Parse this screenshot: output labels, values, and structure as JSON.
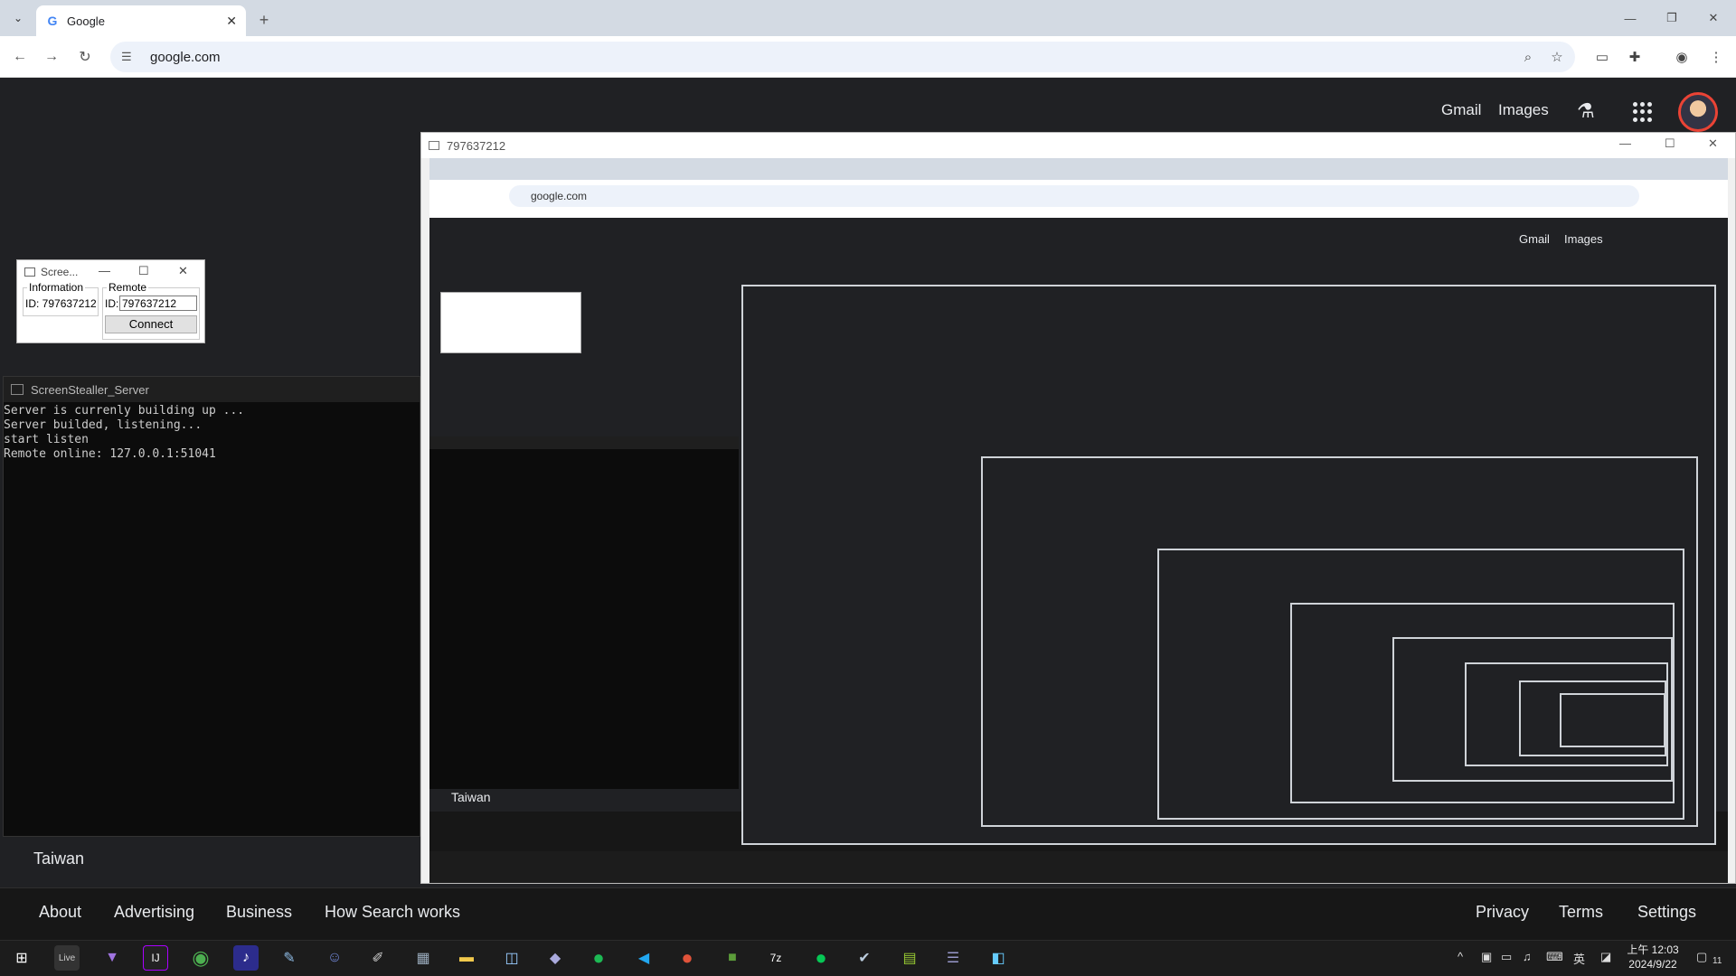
{
  "browser": {
    "tab_title": "Google",
    "url": "google.com"
  },
  "google": {
    "header_links": [
      "Gmail",
      "Images"
    ],
    "country": "Taiwan",
    "footer_left": [
      "About",
      "Advertising",
      "Business",
      "How Search works"
    ],
    "footer_right": [
      "Privacy",
      "Terms",
      "Settings"
    ]
  },
  "dialog": {
    "title": "Scree...",
    "info_label": "Information",
    "info_id": "ID: 797637212",
    "remote_label": "Remote",
    "remote_id_label": "ID:",
    "remote_id_value": "797637212",
    "connect": "Connect"
  },
  "console": {
    "title": "ScreenStealler_Server",
    "lines": [
      "Server is currenly building up ...",
      "Server builded, listening...",
      "start listen",
      "Remote online: 127.0.0.1:51041"
    ]
  },
  "viewer": {
    "title": "797637212"
  },
  "taskbar": {
    "apps": [
      "windows-start",
      "live",
      "visual-studio",
      "intellij",
      "chrome",
      "music",
      "paint",
      "discord",
      "notepad",
      "calculator",
      "files",
      "store",
      "scanner",
      "spotify",
      "vscode",
      "powerpoint",
      "minecraft",
      "7zip",
      "line",
      "steam",
      "notepad-plus",
      "vmware",
      "remote-desktop"
    ],
    "time": "上午 12:03",
    "date": "2024/9/22",
    "ime": "英",
    "notifications": "11"
  }
}
